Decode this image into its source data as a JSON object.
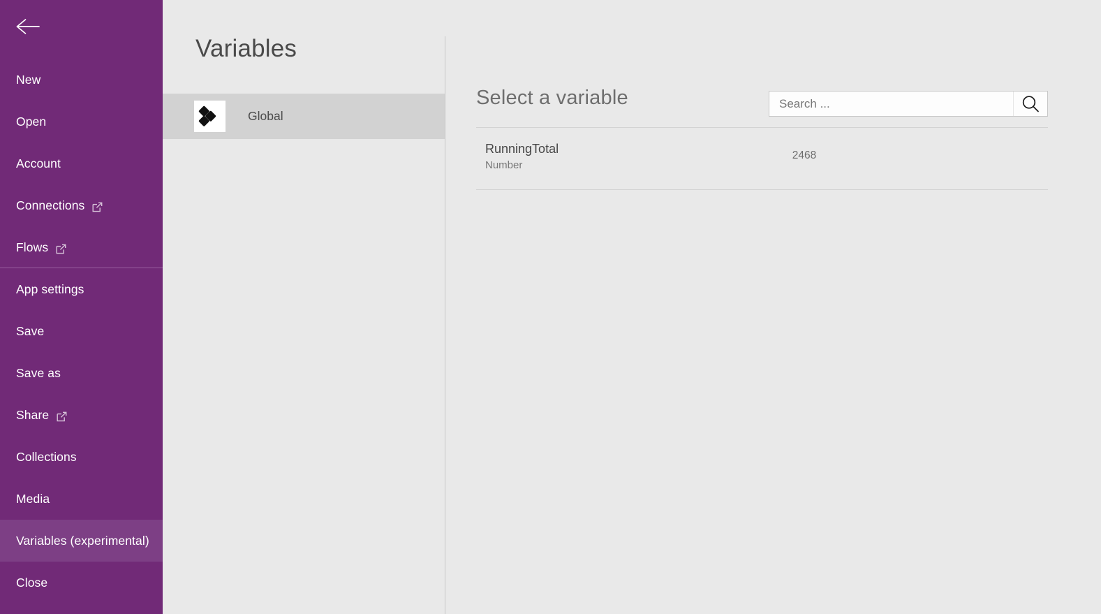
{
  "sidebar": {
    "back_icon": "back-arrow-icon",
    "accent_color": "#712a77",
    "active_color": "#7d3f85",
    "items": [
      {
        "label": "New",
        "icon": null,
        "active": false,
        "separator_above": false
      },
      {
        "label": "Open",
        "icon": null,
        "active": false,
        "separator_above": false
      },
      {
        "label": "Account",
        "icon": null,
        "active": false,
        "separator_above": false
      },
      {
        "label": "Connections",
        "icon": "external-link-icon",
        "active": false,
        "separator_above": false
      },
      {
        "label": "Flows",
        "icon": "external-link-icon",
        "active": false,
        "separator_above": false
      },
      {
        "label": "App settings",
        "icon": null,
        "active": false,
        "separator_above": true
      },
      {
        "label": "Save",
        "icon": null,
        "active": false,
        "separator_above": false
      },
      {
        "label": "Save as",
        "icon": null,
        "active": false,
        "separator_above": false
      },
      {
        "label": "Share",
        "icon": "external-link-icon",
        "active": false,
        "separator_above": false
      },
      {
        "label": "Collections",
        "icon": null,
        "active": false,
        "separator_above": false
      },
      {
        "label": "Media",
        "icon": null,
        "active": false,
        "separator_above": false
      },
      {
        "label": "Variables (experimental)",
        "icon": null,
        "active": true,
        "separator_above": false
      },
      {
        "label": "Close",
        "icon": null,
        "active": false,
        "separator_above": false
      }
    ]
  },
  "panel": {
    "title": "Variables",
    "items": [
      {
        "label": "Global",
        "icon": "global-diamonds-icon",
        "selected": true
      }
    ]
  },
  "main": {
    "title": "Select a variable",
    "search": {
      "placeholder": "Search ...",
      "value": "",
      "icon": "search-icon"
    },
    "variables": [
      {
        "name": "RunningTotal",
        "type": "Number",
        "value": "2468"
      }
    ]
  }
}
